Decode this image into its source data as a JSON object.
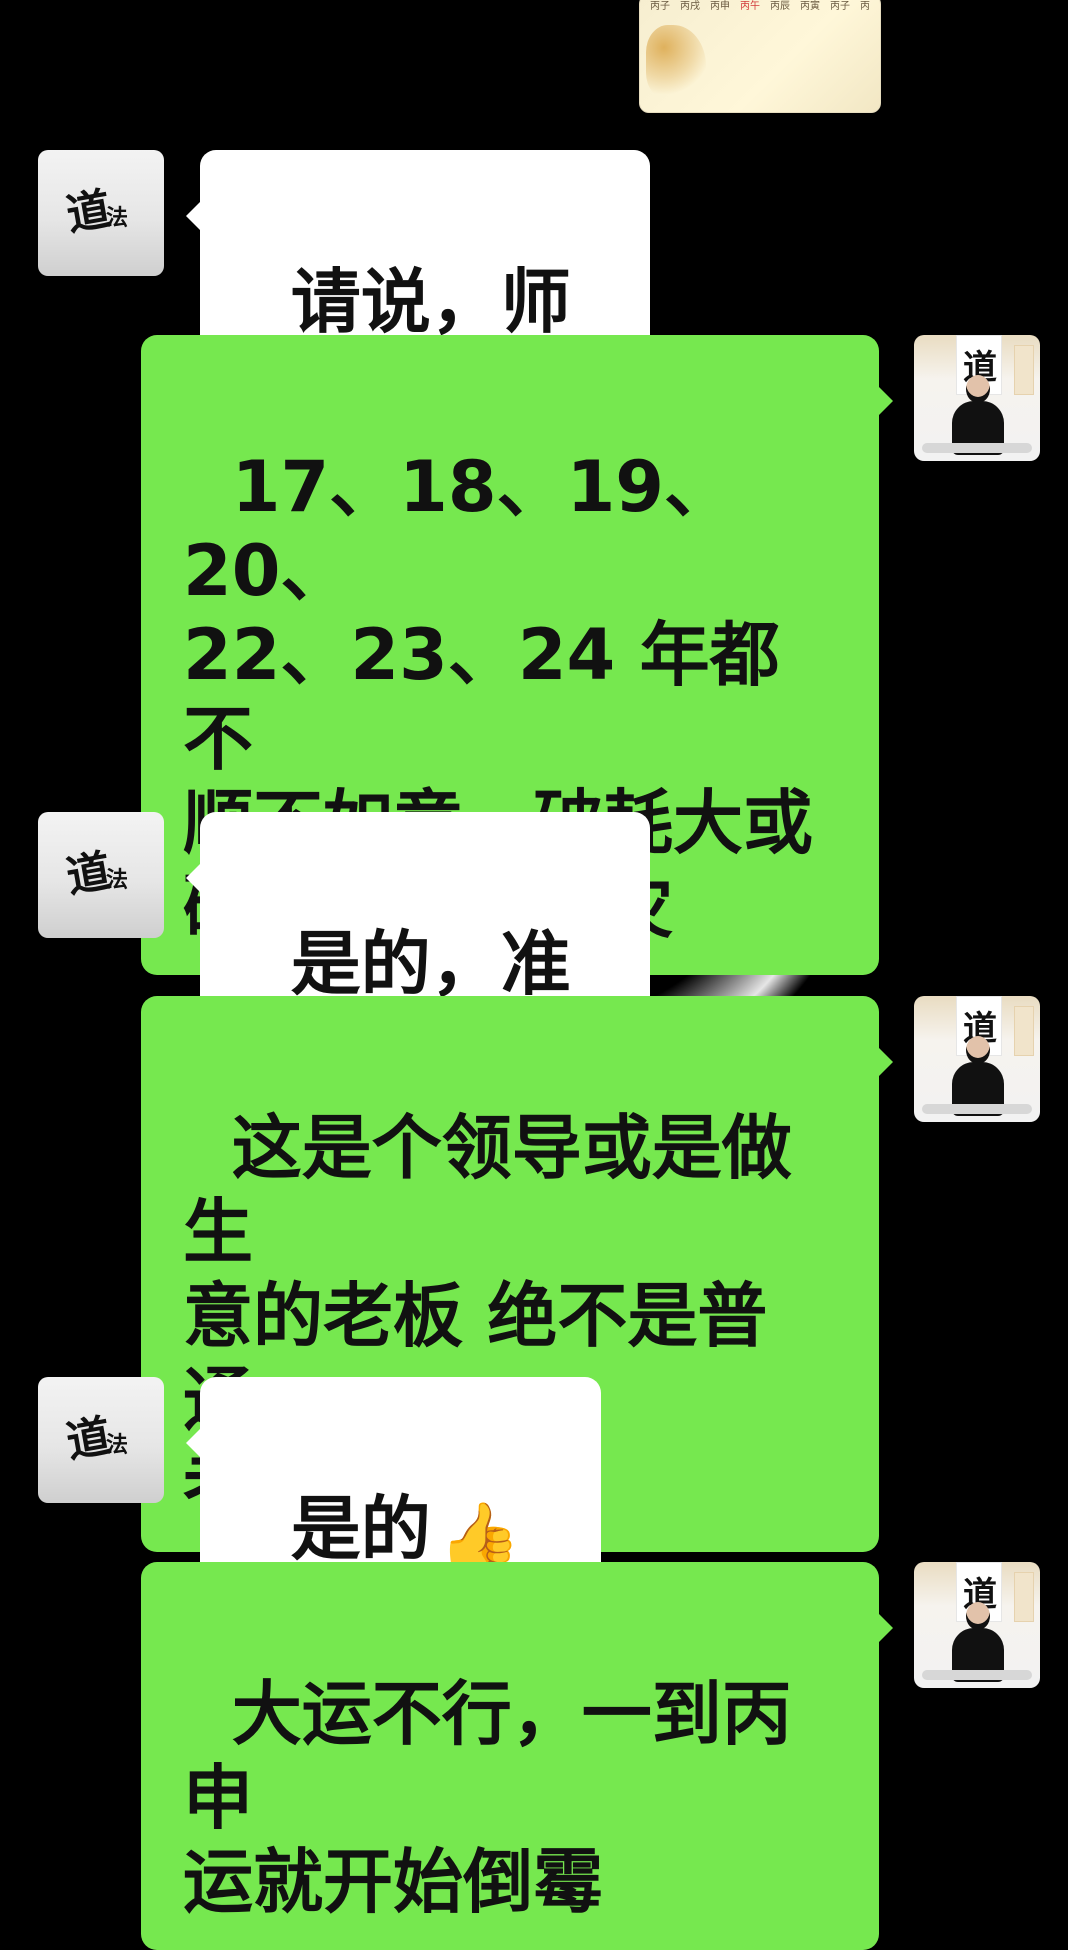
{
  "top_image": {
    "row_labels": [
      "丙子",
      "丙戌",
      "丙申",
      "丙午",
      "丙辰",
      "丙寅",
      "丙子",
      "丙"
    ]
  },
  "messages": [
    {
      "side": "left",
      "text": "请说，师傅",
      "avatar": "logo-avatar"
    },
    {
      "side": "right",
      "text": "17、18、19、20、\n22、23、24 年都不\n顺不如意，破耗大或\n破财，甚至有灾",
      "avatar": "master-avatar"
    },
    {
      "side": "left",
      "text": "是的，准了",
      "avatar": "logo-avatar"
    },
    {
      "side": "right",
      "text": "这是个领导或是做生\n意的老板 绝不是普通\n老百姓",
      "avatar": "master-avatar"
    },
    {
      "side": "left",
      "text": "是的",
      "emoji": "👍👍",
      "avatar": "logo-avatar"
    },
    {
      "side": "right",
      "text": "大运不行，一到丙申\n运就开始倒霉",
      "avatar": "master-avatar"
    }
  ],
  "colors": {
    "background": "#000000",
    "incoming_bubble": "#ffffff",
    "outgoing_bubble": "#76e84f"
  },
  "avatars": {
    "logo-avatar": {
      "icon": "dao-fa-zi-ran-logo-icon"
    },
    "master-avatar": {
      "icon": "master-portrait-icon"
    }
  }
}
